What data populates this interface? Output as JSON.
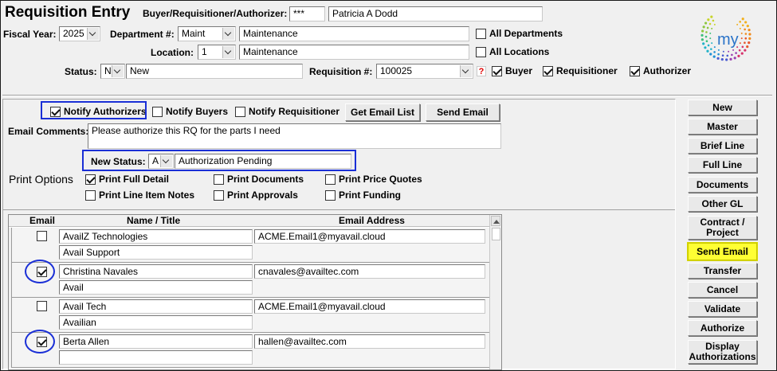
{
  "header": {
    "title": "Requisition Entry",
    "buyer_label": "Buyer/Requisitioner/Authorizer:",
    "buyer_code": "***",
    "buyer_name": "Patricia A  Dodd",
    "fiscal_label": "Fiscal Year:",
    "fiscal_value": "2025",
    "dept_label": "Department #:",
    "dept_code": "Maint",
    "dept_name": "Maintenance",
    "all_departments_label": "All Departments",
    "location_label": "Location:",
    "location_code": "1",
    "location_name": "Maintenance",
    "all_locations_label": "All Locations",
    "status_label": "Status:",
    "status_code": "N",
    "status_name": "New",
    "req_label": "Requisition #:",
    "req_value": "100025",
    "help_glyph": "?",
    "buyer_cb_label": "Buyer",
    "requisitioner_cb_label": "Requisitioner",
    "authorizer_cb_label": "Authorizer",
    "logo_text": "my"
  },
  "email": {
    "notify_authorizers_label": "Notify Authorizers",
    "notify_authorizers_checked": true,
    "notify_buyers_label": "Notify Buyers",
    "notify_requisitioner_label": "Notify Requisitioner",
    "get_email_list_label": "Get Email List",
    "send_email_label": "Send Email",
    "comments_label": "Email Comments:",
    "comments_value": "Please authorize this RQ for the parts I need",
    "new_status_label": "New Status:",
    "new_status_code": "A",
    "new_status_name": "Authorization Pending"
  },
  "print_options": {
    "label": "Print Options",
    "full_detail": "Print Full Detail",
    "documents": "Print Documents",
    "price_quotes": "Print Price Quotes",
    "line_item_notes": "Print Line Item Notes",
    "approvals": "Print Approvals",
    "funding": "Print Funding"
  },
  "grid": {
    "columns": [
      "Email",
      "Name / Title",
      "Email Address"
    ],
    "rows": [
      {
        "checked": false,
        "name": "AvailZ Technologies",
        "title": "Avail Support",
        "email": "ACME.Email1@myavail.cloud"
      },
      {
        "checked": true,
        "name": "Christina Navales",
        "title": "Avail",
        "email": "cnavales@availtec.com"
      },
      {
        "checked": false,
        "name": "Avail Tech",
        "title": "Availian",
        "email": "ACME.Email1@myavail.cloud"
      },
      {
        "checked": true,
        "name": "Berta Allen",
        "title": "",
        "email": "hallen@availtec.com"
      }
    ]
  },
  "sidebar": {
    "buttons": [
      "New",
      "Master",
      "Brief Line",
      "Full Line",
      "Documents",
      "Other GL",
      "Contract /\nProject",
      "Send Email",
      "Transfer",
      "Cancel",
      "Validate",
      "Authorize",
      "Display\nAuthorizations"
    ],
    "highlighted": "Send Email",
    "highlight_color": "#ffff33"
  },
  "colors": {
    "annotation": "#1a2fd6",
    "background": "#f0f0f0"
  }
}
